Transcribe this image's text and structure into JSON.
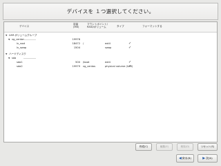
{
  "title": "デバイスを １つ選択してください。",
  "columns": {
    "device": "デバイス",
    "size": "容量\n(MB)",
    "mount": "マウントポイント/\nRAID/ボリューム",
    "type": "タイプ",
    "format": "フォーマットする"
  },
  "rows": [
    {
      "expander": "▼",
      "device": "LVM ボリュームグループ",
      "size": "",
      "mount": "",
      "type": "",
      "format": false,
      "indent": 0
    },
    {
      "expander": "▼",
      "device": "vg_centos",
      "size": "19976",
      "mount": "",
      "type": "",
      "format": false,
      "indent": 1
    },
    {
      "expander": "",
      "device": "lv_root",
      "size": "18472",
      "mount": "/",
      "type": "ext4",
      "format": true,
      "indent": 2
    },
    {
      "expander": "",
      "device": "lv_swap",
      "size": "1504",
      "mount": "",
      "type": "swap",
      "format": true,
      "indent": 2
    },
    {
      "expander": "▼",
      "device": "ハードディスク",
      "size": "",
      "mount": "",
      "type": "",
      "format": false,
      "indent": 0
    },
    {
      "expander": "▼",
      "device": "sda",
      "size": "",
      "mount": "",
      "type": "",
      "format": false,
      "indent": 1
    },
    {
      "expander": "",
      "device": "sda1",
      "size": "500",
      "mount": "/boot",
      "type": "ext4",
      "format": true,
      "indent": 2
    },
    {
      "expander": "",
      "device": "sda2",
      "size": "19979",
      "mount": "vg_centos",
      "type": "physical volume (LVM)",
      "format": true,
      "indent": 2
    }
  ],
  "buttons": {
    "create": "作成(C)",
    "edit": "編集(E)",
    "delete": "削除(D)",
    "reset": "リセット(S)"
  },
  "nav": {
    "back": "戻る(B)",
    "next": "次(N)"
  },
  "check_glyph": "✓"
}
